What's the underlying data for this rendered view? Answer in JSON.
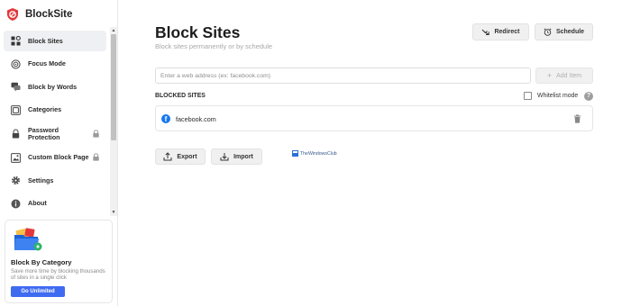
{
  "app": {
    "name": "BlockSite"
  },
  "sidebar": {
    "items": [
      {
        "label": "Block Sites",
        "icon": "block-sites-icon"
      },
      {
        "label": "Focus Mode",
        "icon": "focus-mode-icon"
      },
      {
        "label": "Block by Words",
        "icon": "chat-bubble-icon"
      },
      {
        "label": "Categories",
        "icon": "categories-icon"
      },
      {
        "label": "Password Protection",
        "icon": "password-lock-icon",
        "locked": true
      },
      {
        "label": "Custom Block Page",
        "icon": "custom-page-icon",
        "locked": true
      },
      {
        "label": "Settings",
        "icon": "gear-icon"
      },
      {
        "label": "About",
        "icon": "info-icon"
      }
    ],
    "active": "Block Sites"
  },
  "promo": {
    "title": "Block By Category",
    "text": "Save more time by blocking thousands of sites in a single click",
    "button": "Go Unlimited"
  },
  "main": {
    "title": "Block Sites",
    "subtitle": "Block sites permanently or by schedule",
    "redirect_label": "Redirect",
    "schedule_label": "Schedule",
    "input_placeholder": "Enter a web address (ex: facebook.com)",
    "add_label": "Add Item",
    "blocked_heading": "BLOCKED SITES",
    "whitelist_label": "Whitelist mode",
    "whitelist_checked": false,
    "help_glyph": "?",
    "blocked_sites": [
      {
        "name": "facebook.com",
        "favicon_letter": "f"
      }
    ],
    "export_label": "Export",
    "import_label": "Import"
  },
  "watermark": {
    "text": "TheWindowsClub"
  },
  "colors": {
    "accent": "#3f6bf0",
    "brand": "#e2383b",
    "facebook": "#1877f2"
  }
}
